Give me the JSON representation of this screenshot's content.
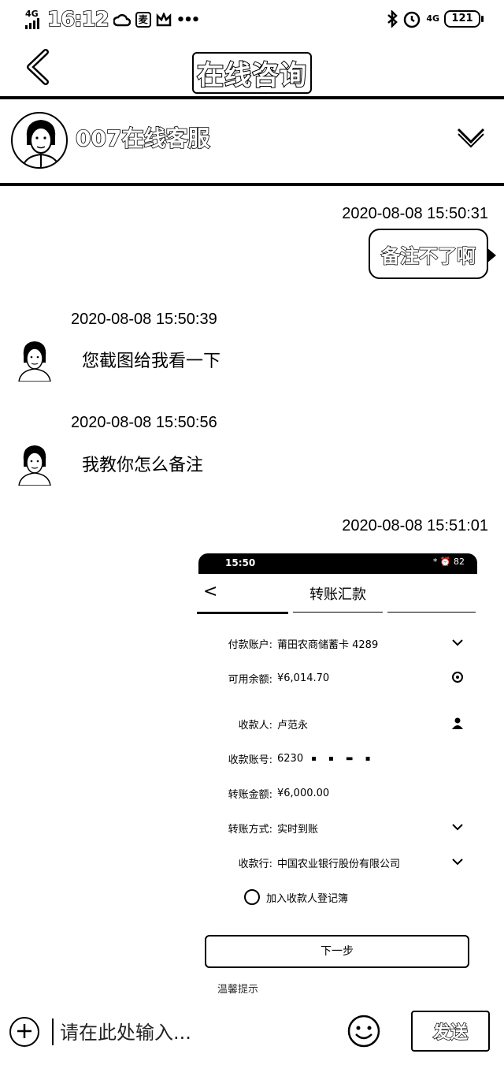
{
  "status_bar": {
    "network": "4G",
    "time": "16:12",
    "app_icon": "麦",
    "dots": "•••",
    "right_network": "4G",
    "battery": "121"
  },
  "nav": {
    "title": "在线咨询"
  },
  "agent": {
    "name": "007在线客服"
  },
  "messages": [
    {
      "side": "right",
      "time": "2020-08-08 15:50:31",
      "text": "备注不了啊"
    },
    {
      "side": "left",
      "time": "2020-08-08 15:50:39",
      "text": "您截图给我看一下"
    },
    {
      "side": "left",
      "time": "2020-08-08 15:50:56",
      "text": "我教你怎么备注"
    },
    {
      "side": "right",
      "time": "2020-08-08 15:51:01",
      "type": "image"
    }
  ],
  "screenshot": {
    "status_time": "15:50",
    "status_right": "*  ⏰ 82",
    "back": "<",
    "title": "转账汇款",
    "fields": [
      {
        "label": "付款账户:",
        "value": "莆田农商储蓄卡 4289",
        "icon": "chevron-down"
      },
      {
        "label": "可用余额:",
        "value": "¥6,014.70",
        "icon": "eye"
      },
      {
        "label": "收款人:",
        "value": "卢范永",
        "icon": "person"
      },
      {
        "label": "收款账号:",
        "value": "6230",
        "icon": ""
      },
      {
        "label": "转账金额:",
        "value": "¥6,000.00",
        "icon": ""
      },
      {
        "label": "转账方式:",
        "value": "实时到账",
        "icon": "chevron-down"
      },
      {
        "label": "收款行:",
        "value": "中国农业银行股份有限公司",
        "icon": "chevron-down"
      }
    ],
    "checkbox_label": "加入收款人登记簿",
    "next_button": "下一步",
    "tip": "温馨提示"
  },
  "input": {
    "placeholder": "请在此处输入...",
    "send_label": "发送"
  }
}
